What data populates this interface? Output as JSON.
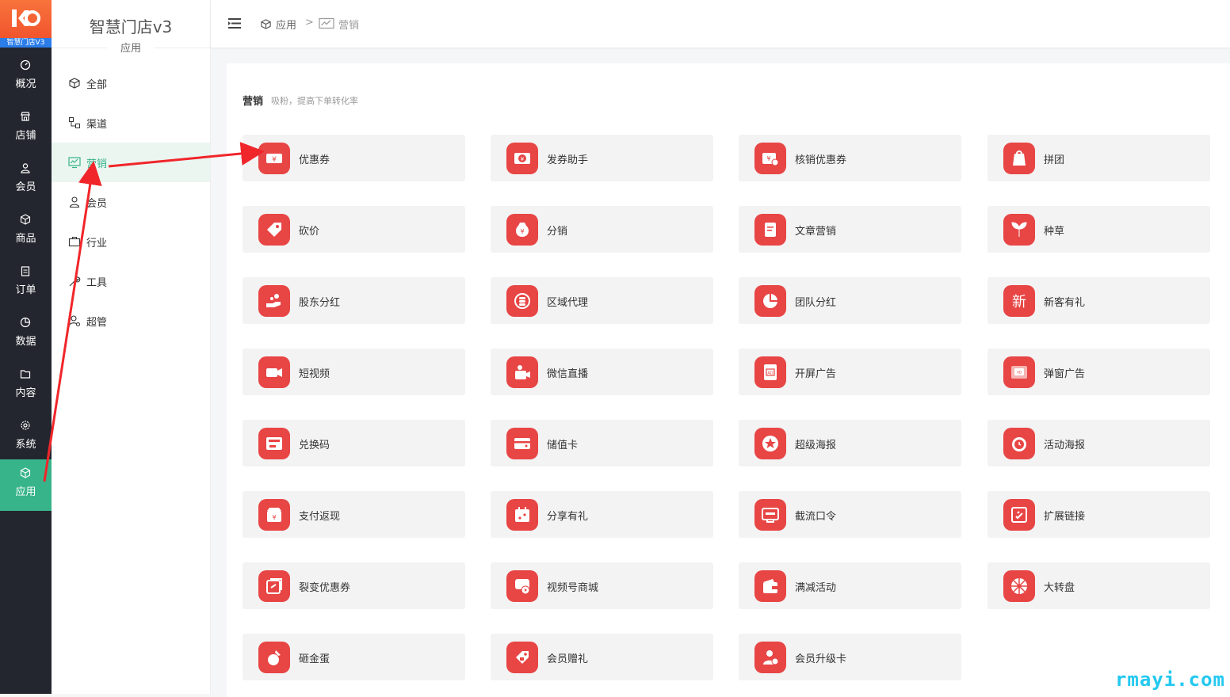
{
  "brand": {
    "badge_text": "智慧门店V3"
  },
  "rail": [
    {
      "label": "概况",
      "icon": "dashboard-icon",
      "active": false
    },
    {
      "label": "店铺",
      "icon": "store-icon",
      "active": false
    },
    {
      "label": "会员",
      "icon": "user-icon",
      "active": false
    },
    {
      "label": "商品",
      "icon": "box-icon",
      "active": false
    },
    {
      "label": "订单",
      "icon": "clipboard-icon",
      "active": false
    },
    {
      "label": "数据",
      "icon": "pie-icon",
      "active": false
    },
    {
      "label": "内容",
      "icon": "folder-icon",
      "active": false
    },
    {
      "label": "系统",
      "icon": "gear-icon",
      "active": false
    },
    {
      "label": "应用",
      "icon": "cube-icon",
      "active": true
    }
  ],
  "sidebar": {
    "title": "智慧门店v3",
    "subtitle": "应用",
    "items": [
      {
        "label": "全部",
        "icon": "cube-icon",
        "active": false
      },
      {
        "label": "渠道",
        "icon": "channel-icon",
        "active": false
      },
      {
        "label": "营销",
        "icon": "chart-monitor-icon",
        "active": true
      },
      {
        "label": "会员",
        "icon": "user-icon",
        "active": false
      },
      {
        "label": "行业",
        "icon": "briefcase-icon",
        "active": false
      },
      {
        "label": "工具",
        "icon": "wrench-icon",
        "active": false
      },
      {
        "label": "超管",
        "icon": "admin-user-icon",
        "active": false
      }
    ]
  },
  "breadcrumb": {
    "root": "应用",
    "separator": ">",
    "current": "营销"
  },
  "section": {
    "title": "营销",
    "description": "吸粉，提高下单转化率"
  },
  "apps": [
    {
      "name": "优惠券",
      "icon": "coupon-icon"
    },
    {
      "name": "发券助手",
      "icon": "coupon-send-icon"
    },
    {
      "name": "核销优惠券",
      "icon": "coupon-verify-icon"
    },
    {
      "name": "拼团",
      "icon": "group-bag-icon"
    },
    {
      "name": "砍价",
      "icon": "price-tag-icon"
    },
    {
      "name": "分销",
      "icon": "money-bag-icon"
    },
    {
      "name": "文章营销",
      "icon": "article-icon"
    },
    {
      "name": "种草",
      "icon": "sprout-icon"
    },
    {
      "name": "股东分红",
      "icon": "hand-coins-icon"
    },
    {
      "name": "区域代理",
      "icon": "coin-stack-icon"
    },
    {
      "name": "团队分红",
      "icon": "pie-chart-icon"
    },
    {
      "name": "新客有礼",
      "icon": "new-char-icon"
    },
    {
      "name": "短视频",
      "icon": "video-camera-icon"
    },
    {
      "name": "微信直播",
      "icon": "live-camera-icon"
    },
    {
      "name": "开屏广告",
      "icon": "ad-screen-icon"
    },
    {
      "name": "弹窗广告",
      "icon": "ad-popup-icon"
    },
    {
      "name": "兑换码",
      "icon": "redeem-card-icon"
    },
    {
      "name": "储值卡",
      "icon": "stored-card-icon"
    },
    {
      "name": "超级海报",
      "icon": "star-poster-icon"
    },
    {
      "name": "活动海报",
      "icon": "clock-poster-icon"
    },
    {
      "name": "支付返现",
      "icon": "cashback-icon"
    },
    {
      "name": "分享有礼",
      "icon": "share-gift-icon"
    },
    {
      "name": "截流口令",
      "icon": "command-screen-icon"
    },
    {
      "name": "扩展链接",
      "icon": "link-icon"
    },
    {
      "name": "裂变优惠券",
      "icon": "fission-coupon-icon"
    },
    {
      "name": "视频号商城",
      "icon": "video-shop-icon"
    },
    {
      "name": "满减活动",
      "icon": "wallet-icon"
    },
    {
      "name": "大转盘",
      "icon": "wheel-icon"
    },
    {
      "name": "砸金蛋",
      "icon": "golden-egg-icon"
    },
    {
      "name": "会员赠礼",
      "icon": "gift-tag-icon"
    },
    {
      "name": "会员升级卡",
      "icon": "member-upgrade-icon"
    }
  ],
  "watermark": "rmayi.com",
  "colors": {
    "accent": "#38b48b",
    "badge": "#e84545",
    "rail": "#23262e",
    "annotation": "#f0262a"
  }
}
